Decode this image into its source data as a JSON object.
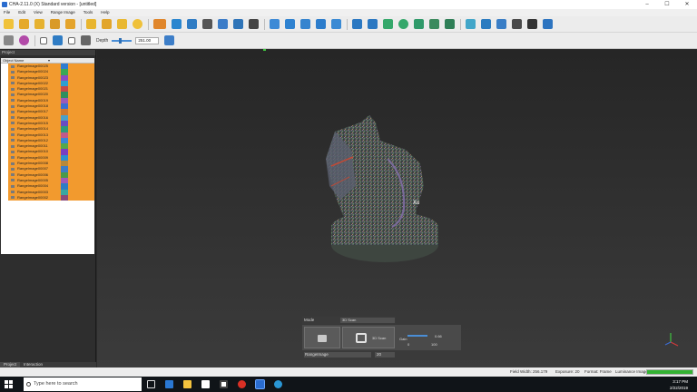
{
  "window": {
    "title": "CHA-2.11.0 (X) Standard version - [untitled]",
    "controls": [
      "–",
      "☐",
      "✕"
    ]
  },
  "menu": [
    "File",
    "Edit",
    "View",
    "Range Image",
    "Tools",
    "Help"
  ],
  "toolbar2": {
    "depth_label": "Depth",
    "depth_value": "251.00"
  },
  "db_tree": {
    "panel_title": "Project",
    "column_name": "Object Name",
    "items": [
      "RangeImage00025",
      "RangeImage00024",
      "RangeImage00023",
      "RangeImage00022",
      "RangeImage00021",
      "RangeImage00020",
      "RangeImage00019",
      "RangeImage00018",
      "RangeImage00017",
      "RangeImage00016",
      "RangeImage00015",
      "RangeImage00014",
      "RangeImage00013",
      "RangeImage00012",
      "RangeImage00011",
      "RangeImage00010",
      "RangeImage00009",
      "RangeImage00008",
      "RangeImage00007",
      "RangeImage00006",
      "RangeImage00005",
      "RangeImage00004",
      "RangeImage00003",
      "RangeImage00002"
    ],
    "tabs": [
      "Project",
      "Interaction"
    ]
  },
  "capture": {
    "mode_label": "Mode",
    "mode_value": "3D Scan",
    "scan_button_label": "3D Scan",
    "gain_label": "Gain",
    "gain_value": "0.66",
    "range_min": "0",
    "range_max": "100",
    "type_value": "RangeImage",
    "count_value": "20"
  },
  "statusbar": {
    "field_width": "Field Width: 256.179",
    "exposure": "Exposure: 20",
    "format": "Format: Frame",
    "luminance": "Luminance Image",
    "progress": 1.0
  },
  "taskbar": {
    "search_placeholder": "Type here to search",
    "time": "3:17 PM",
    "date": "2/22/2019"
  },
  "colors": {
    "tree_highlight": "#f29a2e",
    "accent_blue": "#2d6fb5",
    "progress_green": "#33b233"
  }
}
